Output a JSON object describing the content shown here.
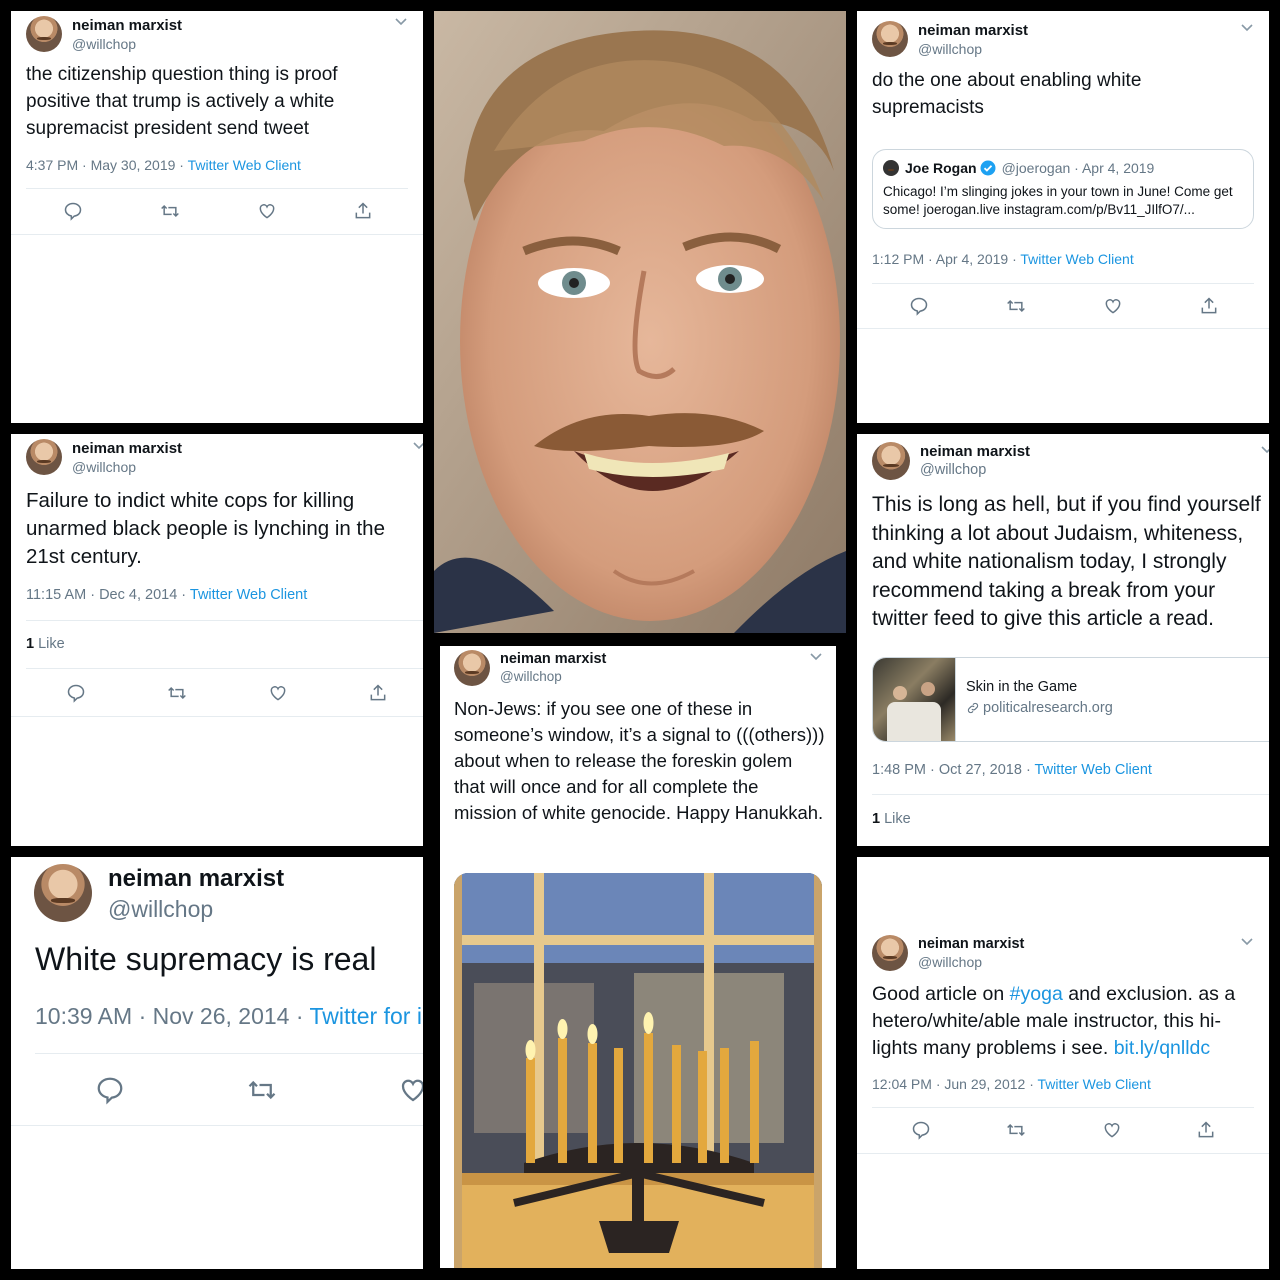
{
  "user": {
    "display_name": "neiman marxist",
    "handle": "@willchop"
  },
  "tweet1": {
    "text": "the citizenship question thing is proof positive that trump is actively a white supremacist president send tweet",
    "time": "4:37 PM · May 30, 2019 · ",
    "client": "Twitter Web Client"
  },
  "tweet2": {
    "text": "do the one about enabling white supremacists",
    "time": "1:12 PM · Apr 4, 2019 · ",
    "client": "Twitter Web Client",
    "quote": {
      "name": "Joe Rogan",
      "handle": "@joerogan · Apr 4, 2019",
      "text": "Chicago! I’m slinging jokes in your town in June! Come get some! joerogan.live instagram.com/p/Bv11_JIlfO7/..."
    }
  },
  "tweet3": {
    "text": "Failure to indict white cops for killing unarmed black people is lynching in the 21st century.",
    "time": "11:15 AM · Dec 4, 2014 · ",
    "client": "Twitter Web Client",
    "likes_count": "1",
    "likes_label": " Like"
  },
  "tweet4": {
    "text": "This is long as hell, but if you find yourself thinking a lot about Judaism, whiteness, and white nationalism today, I strongly recommend taking a break from your twitter feed to give this article a read.",
    "time": "1:48 PM · Oct 27, 2018 · ",
    "client": "Twitter Web Client",
    "card": {
      "title": "Skin in the Game",
      "domain": "politicalresearch.org"
    },
    "likes_count": "1",
    "likes_label": " Like"
  },
  "tweet5": {
    "text": "Non-Jews: if you see one of these in someone’s window, it’s a signal to (((others))) about when to release the foreskin golem that will once and for all complete the mission of white genocide. Happy Hanukkah."
  },
  "tweet6": {
    "text": "White supremacy is real",
    "time": "10:39 AM · Nov 26, 2014 · ",
    "client": "Twitter for i"
  },
  "tweet7": {
    "text_a": "Good article on ",
    "hashtag": "#yoga",
    "text_b": " and exclusion. as a hetero/white/able male instructor, this hi-lights many problems i see. ",
    "url": "bit.ly/qnlldc",
    "time": "12:04 PM · Jun 29, 2012 · ",
    "client": "Twitter Web Client"
  },
  "icons": [
    "reply-icon",
    "retweet-icon",
    "like-icon",
    "share-icon",
    "chevron-down-icon",
    "verified-icon",
    "link-icon"
  ],
  "colors": {
    "accent": "#1b95e0",
    "text": "#0f1419",
    "muted": "#657786",
    "divider": "#e6ecf0",
    "background": "#000000"
  }
}
